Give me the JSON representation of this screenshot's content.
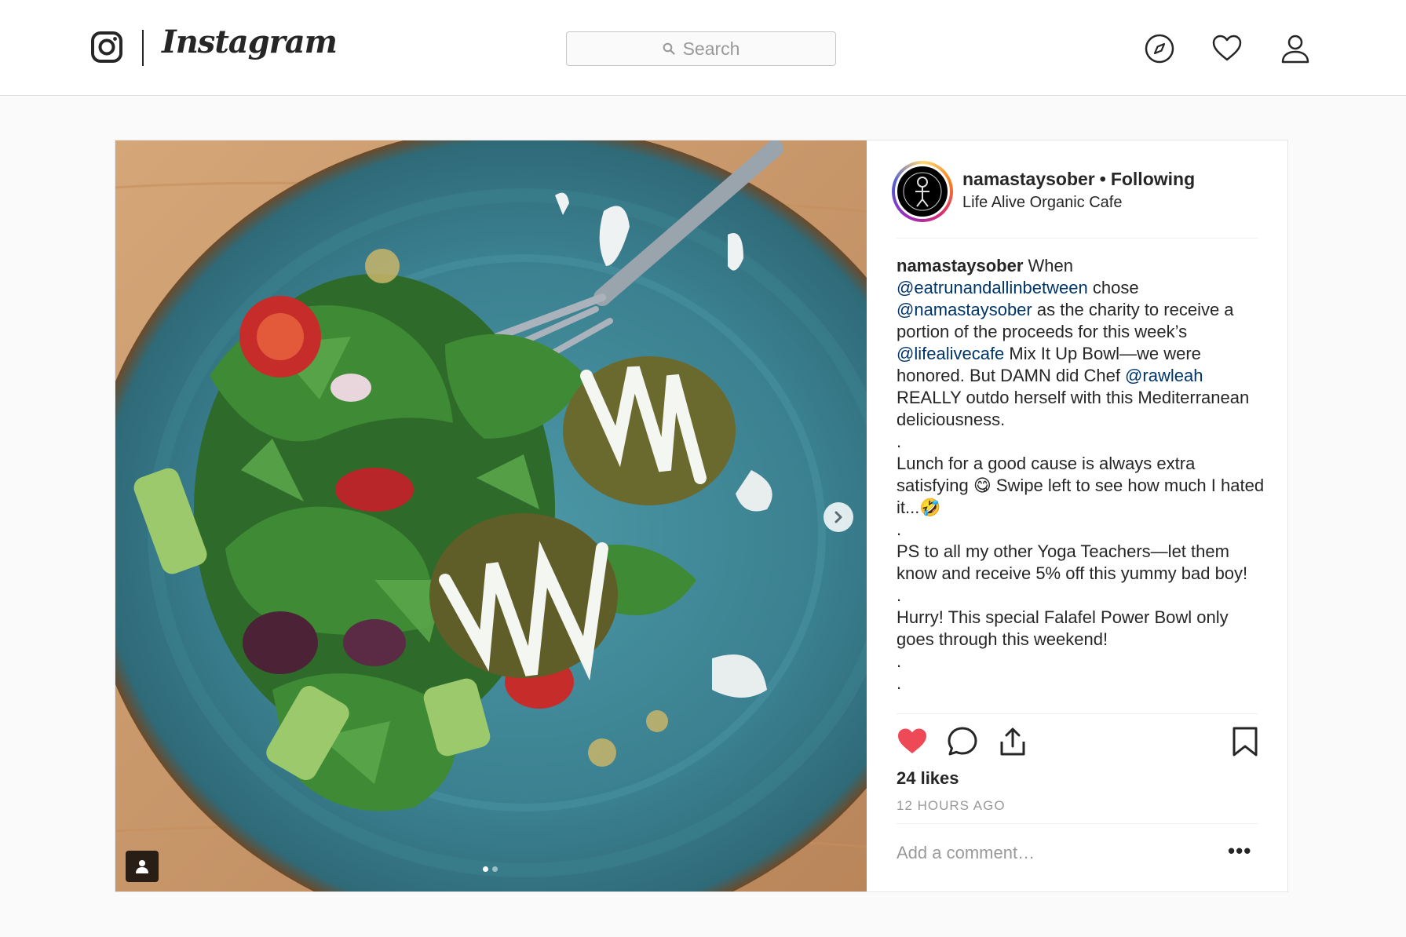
{
  "header": {
    "brand": "Instagram",
    "search_placeholder": "Search",
    "icons": [
      "instagram-glyph-icon",
      "compass-icon",
      "heart-icon",
      "profile-icon"
    ]
  },
  "post": {
    "username": "namastaysober",
    "follow_separator": "•",
    "follow_status": "Following",
    "location": "Life Alive Organic Cafe",
    "caption": {
      "author": "namastaysober",
      "line1_text": " When ",
      "mention1": "@eatrunandallinbetween",
      "line2_text": " chose ",
      "mention2": "@namastaysober",
      "line3_text": " as the charity to receive a portion of the proceeds for this week’s ",
      "mention3": "@lifealivecafe",
      "line4_text": " Mix It Up Bowl—we were honored. But DAMN did Chef ",
      "mention4": "@rawleah",
      "line5_text": " REALLY outdo herself with this Mediterranean deliciousness.",
      "dot1": ".",
      "para2": "Lunch for a good cause is always extra satisfying 😋  Swipe left to see how much I hated it...🤣",
      "dot2": ".",
      "para3": "PS to all my other Yoga Teachers—let them know and receive 5% off this yummy bad boy!",
      "dot3": ".",
      "para4": "Hurry! This special Falafel Power Bowl only goes through this weekend!",
      "dot4": ".",
      "dot5": "."
    },
    "liked": true,
    "likes_text": "24 likes",
    "timestamp": "12 HOURS AGO",
    "comment_placeholder": "Add a comment…",
    "more_label": "•••",
    "carousel": {
      "current": 1,
      "total": 2
    }
  },
  "colors": {
    "like_red": "#ed4956",
    "mention_blue": "#003569",
    "muted_gray": "#999999",
    "plate_teal": "#3f8a9a"
  }
}
